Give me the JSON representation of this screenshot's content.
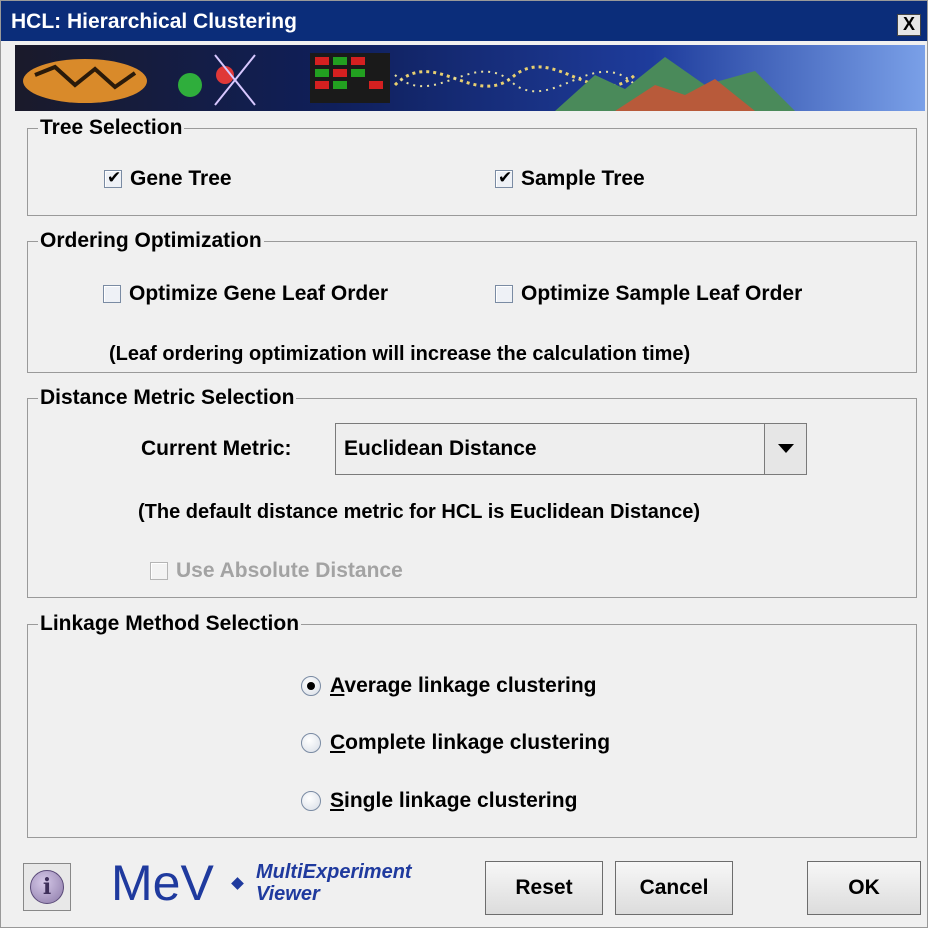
{
  "window": {
    "title": "HCL: Hierarchical Clustering",
    "close_label": "X"
  },
  "tree_selection": {
    "legend": "Tree Selection",
    "gene_tree": {
      "label": "Gene Tree",
      "checked": true
    },
    "sample_tree": {
      "label": "Sample Tree",
      "checked": true
    }
  },
  "ordering": {
    "legend": "Ordering Optimization",
    "gene_leaf": {
      "label": "Optimize Gene Leaf Order",
      "checked": false
    },
    "sample_leaf": {
      "label": "Optimize Sample Leaf Order",
      "checked": false
    },
    "note": "(Leaf ordering optimization will increase the calculation time)"
  },
  "distance": {
    "legend": "Distance Metric Selection",
    "current_label": "Current Metric:",
    "selected": "Euclidean Distance",
    "note": "(The default distance metric for HCL is Euclidean Distance)",
    "absolute": {
      "label": "Use Absolute Distance",
      "checked": false,
      "enabled": false
    }
  },
  "linkage": {
    "legend": "Linkage Method Selection",
    "options": [
      {
        "mnemonic": "A",
        "rest": "verage linkage clustering",
        "selected": true
      },
      {
        "mnemonic": "C",
        "rest": "omplete linkage clustering",
        "selected": false
      },
      {
        "mnemonic": "S",
        "rest": "ingle linkage clustering",
        "selected": false
      }
    ]
  },
  "footer": {
    "info_icon": "i",
    "logo_text": "MeV",
    "logo_sub_line1": "MultiExperiment",
    "logo_sub_line2": "Viewer",
    "reset": "Reset",
    "cancel": "Cancel",
    "ok": "OK"
  },
  "colors": {
    "title_bar": "#0b2d7a",
    "logo": "#1f3a9e"
  }
}
